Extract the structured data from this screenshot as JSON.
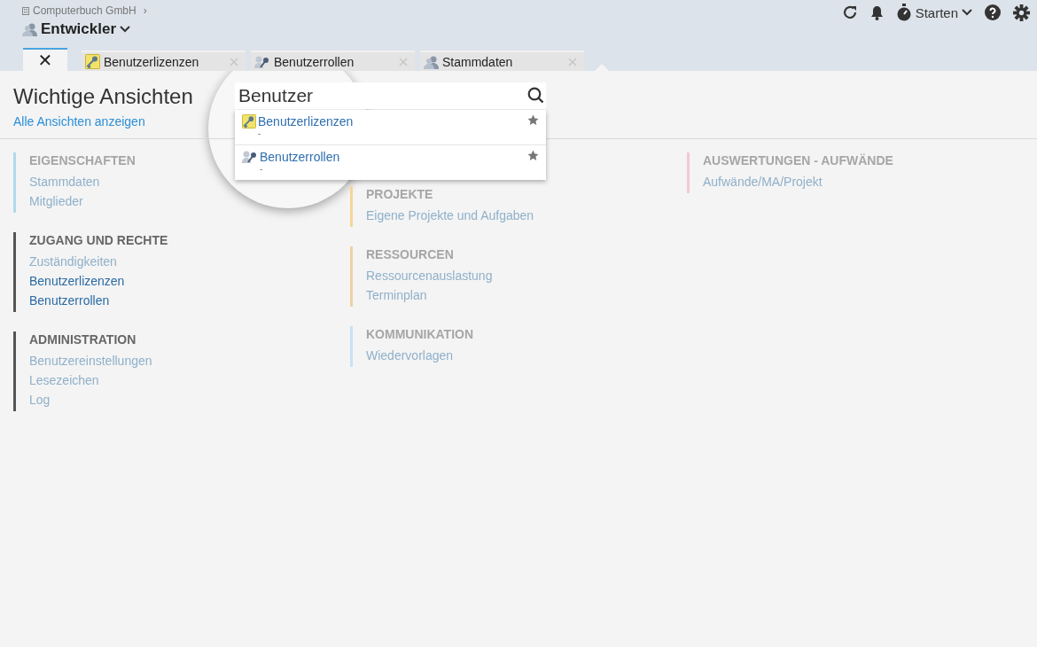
{
  "breadcrumb": {
    "company": "Computerbuch GmbH",
    "separator": "›"
  },
  "workspace": {
    "title": "Entwickler"
  },
  "tabs": [
    {
      "label": "✕",
      "selected": true,
      "kind": "close"
    },
    {
      "label": "Benutzerlizenzen",
      "selected": false,
      "kind": "license"
    },
    {
      "label": "Benutzerrollen",
      "selected": false,
      "kind": "roles"
    },
    {
      "label": "Stammdaten",
      "selected": false,
      "kind": "users"
    }
  ],
  "toolbar": {
    "start_label": "Starten"
  },
  "page": {
    "title": "Wichtige Ansichten",
    "link": "Alle Ansichten anzeigen"
  },
  "search": {
    "value": "Benutzer",
    "results": [
      {
        "title": "Benutzerlizenzen",
        "subtitle": "-",
        "kind": "license"
      },
      {
        "title": "Benutzerrollen",
        "subtitle": "-",
        "kind": "roles"
      }
    ]
  },
  "columns": [
    {
      "groups": [
        {
          "title": "EIGENSCHAFTEN",
          "active": false,
          "color": "#b3d9ec",
          "items": [
            {
              "label": "Stammdaten",
              "enabled": false
            },
            {
              "label": "Mitglieder",
              "enabled": false
            }
          ]
        },
        {
          "title": "ZUGANG UND RECHTE",
          "active": true,
          "color": "#555555",
          "items": [
            {
              "label": "Zuständigkeiten",
              "enabled": false
            },
            {
              "label": "Benutzerlizenzen",
              "enabled": true
            },
            {
              "label": "Benutzerrollen",
              "enabled": true
            }
          ]
        },
        {
          "title": "ADMINISTRATION",
          "active": true,
          "color": "#555555",
          "items": [
            {
              "label": "Benutzereinstellungen",
              "enabled": false
            },
            {
              "label": "Lesezeichen",
              "enabled": false
            },
            {
              "label": "Log",
              "enabled": false
            }
          ]
        }
      ]
    },
    {
      "groups": [
        {
          "title": "PROJEKTE",
          "active": false,
          "color": "#f5d49a",
          "items": [
            {
              "label": "Eigene Projekte und Aufgaben",
              "enabled": false
            }
          ]
        },
        {
          "title": "RESSOURCEN",
          "active": false,
          "color": "#efd0a4",
          "items": [
            {
              "label": "Ressourcenauslastung",
              "enabled": false
            },
            {
              "label": "Terminplan",
              "enabled": false
            }
          ]
        },
        {
          "title": "KOMMUNIKATION",
          "active": false,
          "color": "#c8e2f4",
          "items": [
            {
              "label": "Wiedervorlagen",
              "enabled": false
            }
          ]
        }
      ]
    },
    {
      "groups": [
        {
          "title": "AUSWERTUNGEN - AUFWÄNDE",
          "active": false,
          "color": "#f2c9d4",
          "items": [
            {
              "label": "Aufwände/MA/Projekt",
              "enabled": false
            }
          ]
        }
      ]
    }
  ]
}
